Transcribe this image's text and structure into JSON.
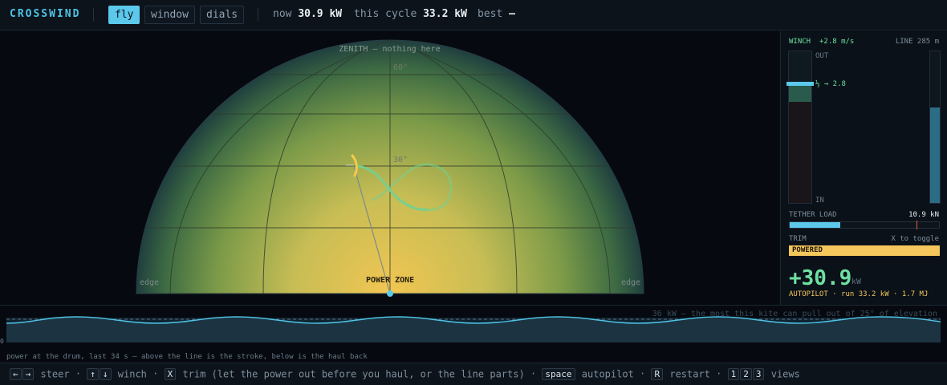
{
  "app": {
    "title": "CROSSWIND"
  },
  "tabs": [
    {
      "label": "fly",
      "active": true
    },
    {
      "label": "window",
      "active": false
    },
    {
      "label": "dials",
      "active": false
    }
  ],
  "stats": {
    "now_label": "now",
    "now_value": "30.9 kW",
    "cycle_label": "this cycle",
    "cycle_value": "33.2 kW",
    "best_label": "best",
    "best_value": "—"
  },
  "sky": {
    "zenith_label": "ZENITH — nothing here",
    "elev_60": "60°",
    "elev_30": "30°",
    "edge_left": "edge",
    "edge_right": "edge",
    "power_zone": "POWER ZONE"
  },
  "panel": {
    "winch_label": "WINCH",
    "winch_speed": "+2.8 m/s",
    "line_length": "LINE 285 m",
    "gauge_out": "OUT",
    "gauge_in": "IN",
    "gauge_marker": "⅓ → 2.8",
    "reel_level": 0.63,
    "tether_label": "TETHER LOAD",
    "tether_value": "10.9 kN",
    "tether_fraction": 0.34,
    "tether_limit_fraction": 0.85,
    "trim_label": "TRIM",
    "trim_hint": "X to toggle",
    "trim_state": "POWERED",
    "power_big": "+30.9",
    "power_unit": "kW",
    "autopilot_line": "AUTOPILOT · run 33.2 kW · 1.7 MJ"
  },
  "strip": {
    "threshold_note": "36 kW — the most this kite can pull out of 25° of elevation",
    "zero_label": "0",
    "caption": "power at the drum, last 34 s — above the line is the stroke, below is the haul back"
  },
  "keys": {
    "steer_keys": [
      "←",
      "→"
    ],
    "steer_label": "steer",
    "winch_keys": [
      "↑",
      "↓"
    ],
    "winch_label": "winch",
    "trim_key": "X",
    "trim_label": "trim (let the power out before you haul, or the line parts)",
    "autopilot_key": "space",
    "autopilot_label": "autopilot",
    "restart_key": "R",
    "restart_label": "restart",
    "view_keys": [
      "1",
      "2",
      "3"
    ],
    "views_label": "views"
  },
  "colors": {
    "accent": "#5cc8ec",
    "power_green": "#6ee0a2",
    "trim_yellow": "#f4c65c",
    "kite_yellow": "#f6c94a",
    "load_limit": "#e06050"
  }
}
